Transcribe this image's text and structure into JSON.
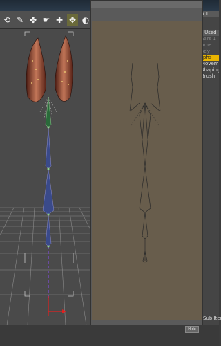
{
  "toolbar": {
    "icons": [
      "rotate-tool-icon",
      "joint-tool-icon",
      "morph-brush-icon",
      "grab-tool-icon",
      "bone-tool-icon",
      "direct-manip-icon",
      "light-icon"
    ],
    "glyphs": [
      "⟲",
      "✎",
      "✤",
      "☛",
      "✚",
      "✥",
      "◐"
    ],
    "active_index": 5
  },
  "right_panel": {
    "rows": [
      {
        "label": "a 1",
        "style": "tab"
      },
      {
        "label": "",
        "style": "normal"
      },
      {
        "label": "",
        "style": "normal"
      },
      {
        "label": "r Used",
        "style": "tab"
      },
      {
        "label": "Ears 1",
        "style": "dim"
      },
      {
        "label": "ame",
        "style": "dim"
      },
      {
        "label": "ody",
        "style": "dim"
      },
      {
        "label": "rphs",
        "style": "highlight"
      },
      {
        "label": "Movement",
        "style": "normal"
      },
      {
        "label": "Shaping",
        "style": "normal"
      },
      {
        "label": "Brush",
        "style": "normal"
      }
    ],
    "sub_items_label": "Sub Items"
  },
  "footer": {
    "button_label": "Hide"
  }
}
